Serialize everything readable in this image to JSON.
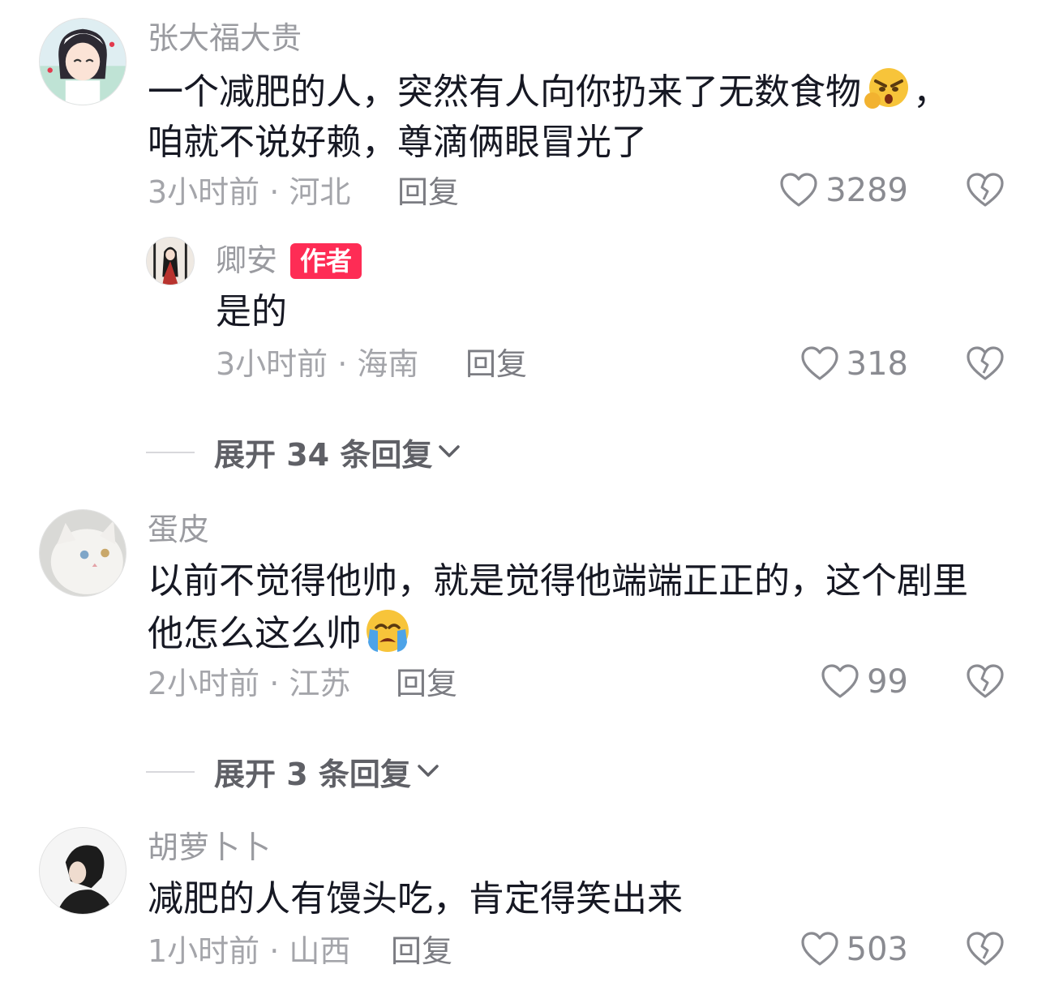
{
  "comments": [
    {
      "username": "张大福大贵",
      "content_lines": [
        "一个减肥的人，突然有人向你扔来了无数食物",
        "，",
        "咱就不说好赖，尊滴俩眼冒光了"
      ],
      "emoji": "angry-face-emoji",
      "time_location": "3小时前 · 河北",
      "reply_label": "回复",
      "likes": "3289",
      "replies": [
        {
          "username": "卿安",
          "badge": "作者",
          "content": "是的",
          "time_location": "3小时前 · 海南",
          "reply_label": "回复",
          "likes": "318"
        }
      ],
      "expand_label": "展开 34 条回复"
    },
    {
      "username": "蛋皮",
      "content_lines": [
        "以前不觉得他帅，就是觉得他端端正正的，这个剧里",
        "他怎么这么帅"
      ],
      "emoji": "crying-face-emoji",
      "time_location": "2小时前 · 江苏",
      "reply_label": "回复",
      "likes": "99",
      "expand_label": "展开 3 条回复"
    },
    {
      "username": "胡萝卜卜",
      "content_lines": [
        "减肥的人有馒头吃，肯定得笑出来"
      ],
      "time_location": "1小时前 · 山西",
      "reply_label": "回复",
      "likes": "503"
    }
  ],
  "icons": {
    "like": "heart-outline-icon",
    "dislike": "broken-heart-icon",
    "expand": "chevron-down-icon"
  },
  "colors": {
    "author_badge": "#fe2c55",
    "meta_text": "#a4a5aa"
  }
}
